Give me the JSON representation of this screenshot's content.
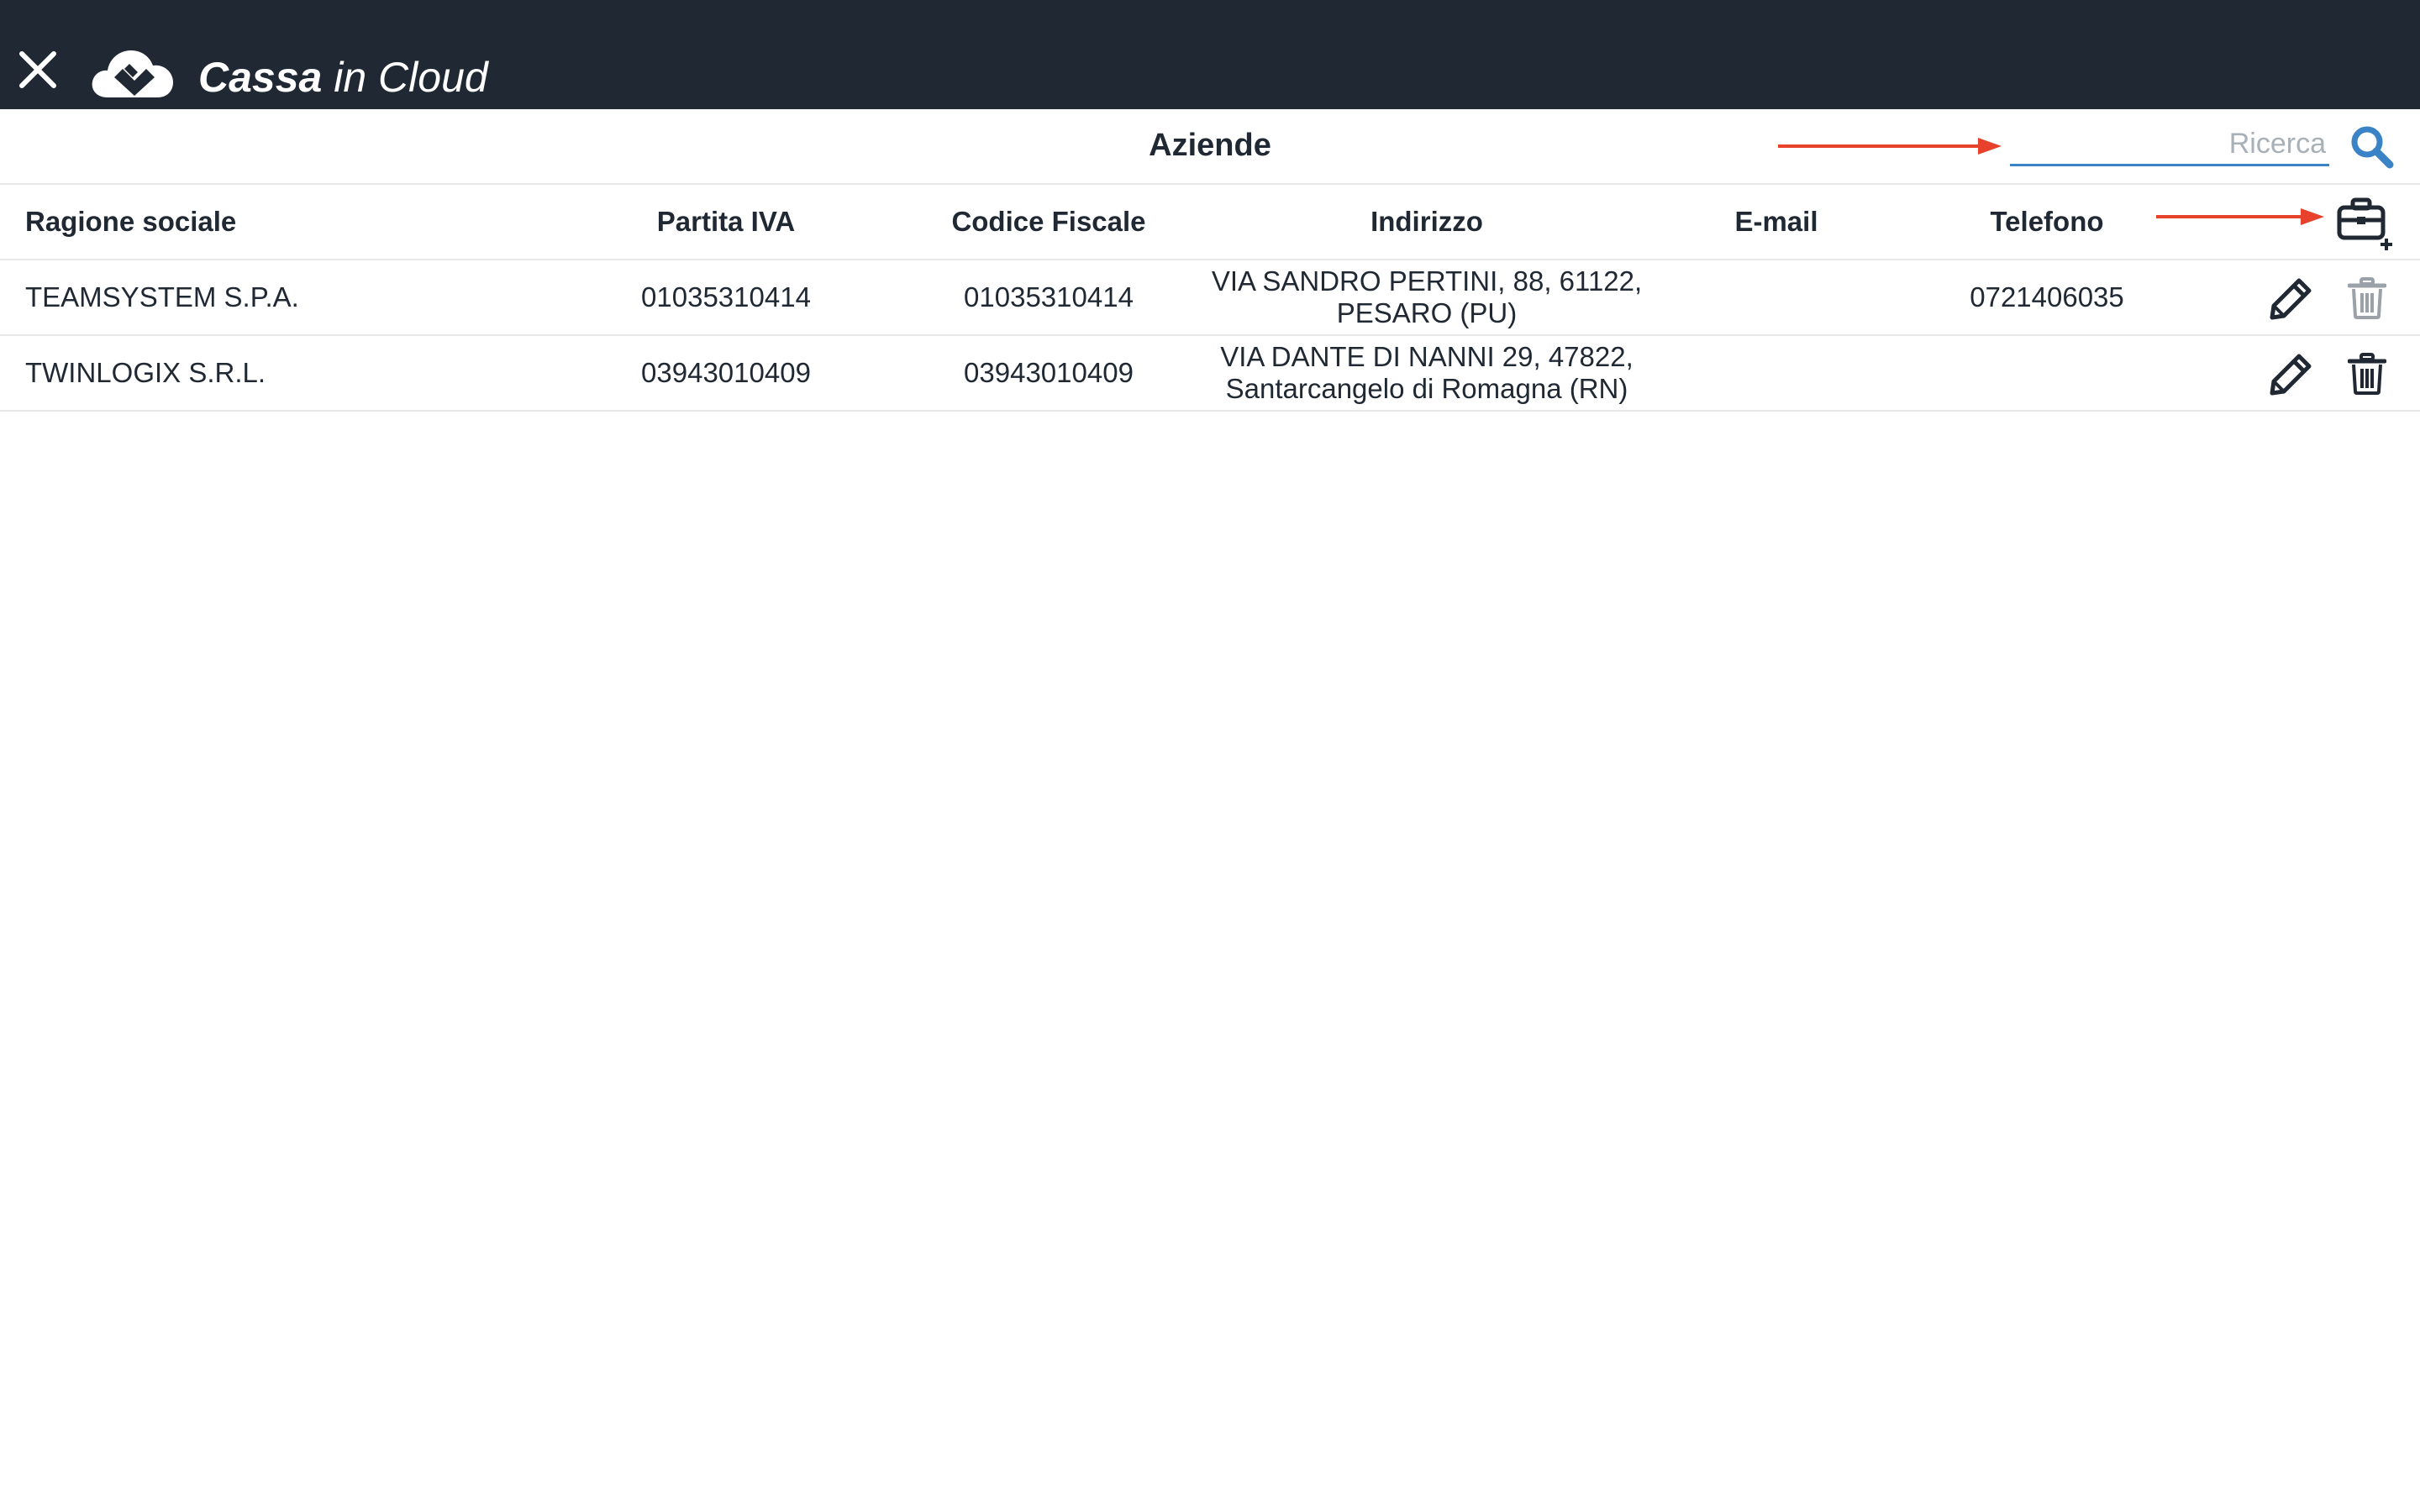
{
  "app": {
    "brand_bold": "Cassa",
    "brand_light": " in Cloud"
  },
  "page": {
    "title": "Aziende"
  },
  "search": {
    "placeholder": "Ricerca",
    "value": ""
  },
  "table": {
    "headers": {
      "name": "Ragione sociale",
      "piva": "Partita IVA",
      "cf": "Codice Fiscale",
      "address": "Indirizzo",
      "email": "E-mail",
      "phone": "Telefono"
    },
    "rows": [
      {
        "name": "TEAMSYSTEM S.P.A.",
        "piva": "01035310414",
        "cf": "01035310414",
        "address_line1": "VIA SANDRO PERTINI, 88, 61122,",
        "address_line2": "PESARO (PU)",
        "email": "",
        "phone": "0721406035",
        "delete_enabled": false
      },
      {
        "name": "TWINLOGIX S.R.L.",
        "piva": "03943010409",
        "cf": "03943010409",
        "address_line1": "VIA DANTE DI NANNI 29, 47822,",
        "address_line2": "Santarcangelo di Romagna (RN)",
        "email": "",
        "phone": "",
        "delete_enabled": true
      }
    ]
  },
  "colors": {
    "topbar": "#1f2833",
    "accent": "#3a83c6",
    "annotation_arrow": "#e8412c",
    "icon_dark": "#1f2833",
    "icon_disabled": "#9aa1a8"
  },
  "icons": {
    "close": "close-icon",
    "logo": "cloud-logo-icon",
    "search": "search-icon",
    "add_company": "briefcase-plus-icon",
    "edit": "pencil-icon",
    "delete": "trash-icon"
  }
}
